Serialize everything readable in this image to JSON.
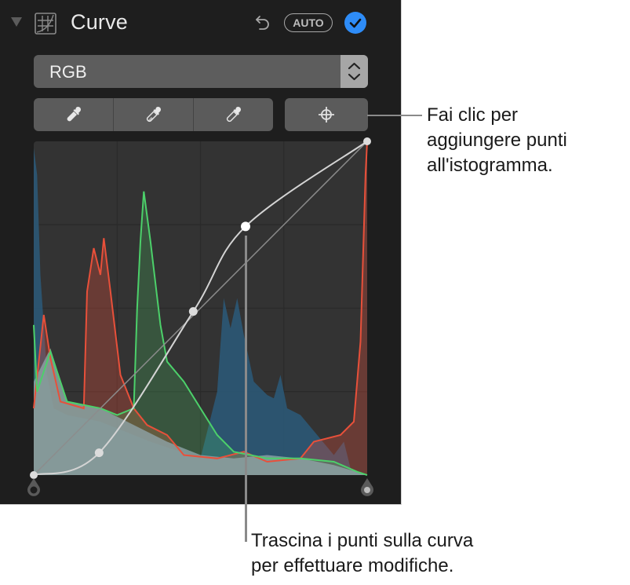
{
  "panel": {
    "title": "Curve",
    "auto_label": "AUTO",
    "icons": {
      "disclosure": "disclosure-triangle-down-icon",
      "section": "curve-icon",
      "undo": "undo-icon",
      "enabled": "checkmark-circle-icon"
    },
    "enabled": true,
    "accent_color": "#2e8cf7"
  },
  "channel_select": {
    "selected": "RGB"
  },
  "tools": {
    "eyedroppers": [
      {
        "name": "black-point-eyedropper",
        "fill": "solid"
      },
      {
        "name": "gray-point-eyedropper",
        "fill": "half"
      },
      {
        "name": "white-point-eyedropper",
        "fill": "outline"
      }
    ],
    "add_point_icon": "crosshair-icon"
  },
  "histogram": {
    "channel_colors": {
      "red": "#e8503a",
      "green": "#4cd06a",
      "blue": "#2b5a7a",
      "luminance": "#8fa4a8"
    },
    "curve_points": [
      [
        0,
        0
      ],
      [
        50,
        17
      ],
      [
        122,
        125
      ],
      [
        162,
        190
      ],
      [
        255,
        255
      ]
    ],
    "black_point": 0,
    "white_point": 255
  },
  "callouts": [
    {
      "id": "add-points",
      "lines": [
        "Fai clic per",
        "aggiungere punti",
        "all'istogramma."
      ]
    },
    {
      "id": "drag-points",
      "lines": [
        "Trascina i punti sulla curva",
        "per effettuare modifiche."
      ]
    }
  ]
}
